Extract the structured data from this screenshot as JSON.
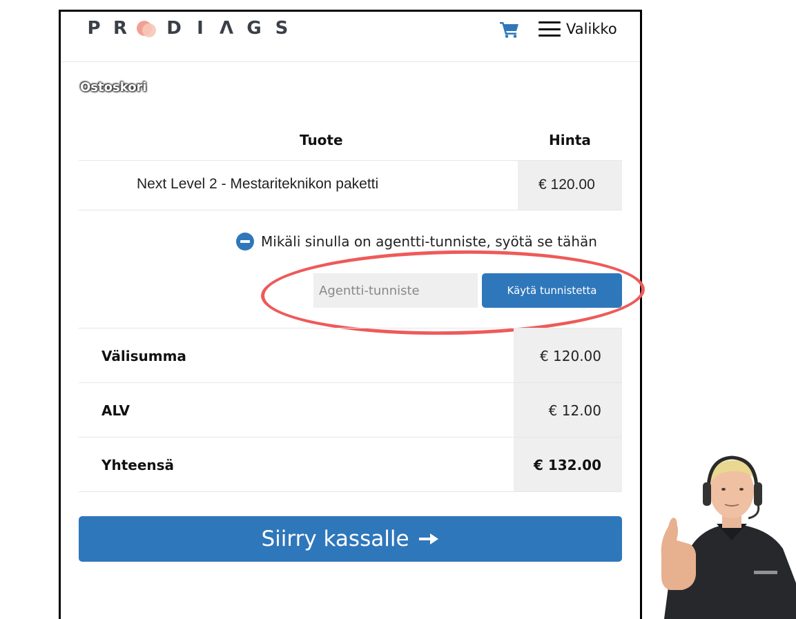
{
  "brand": {
    "logo_left": "PR",
    "logo_right": "DIAGS"
  },
  "header": {
    "cart_icon": "shopping-cart-icon",
    "menu_icon": "hamburger-menu-icon",
    "menu_label": "Valikko"
  },
  "page": {
    "title": "Ostoskori"
  },
  "cart_table": {
    "columns": [
      "Tuote",
      "Hinta"
    ],
    "rows": [
      {
        "product": "Next Level 2 - Mestariteknikon paketti",
        "price": "€ 120.00"
      }
    ]
  },
  "agent": {
    "toggle_icon": "minus-circle-icon",
    "toggle_text": "Mikäli sinulla on agentti-tunniste, syötä se tähän",
    "input_value": "",
    "input_placeholder": "Agentti-tunniste",
    "apply_label": "Käytä tunnistetta"
  },
  "summary": {
    "rows": [
      {
        "label": "Välisumma",
        "value": "€ 120.00"
      },
      {
        "label": "ALV",
        "value": "€ 12.00"
      },
      {
        "label": "Yhteensä",
        "value": "€ 132.00"
      }
    ]
  },
  "checkout": {
    "label": "Siirry kassalle",
    "icon": "arrow-right-icon"
  },
  "colors": {
    "accent": "#2f77bb",
    "highlight": "#ee5a5a",
    "logo_dot": "#f1a193",
    "cell_bg": "#efefef"
  }
}
